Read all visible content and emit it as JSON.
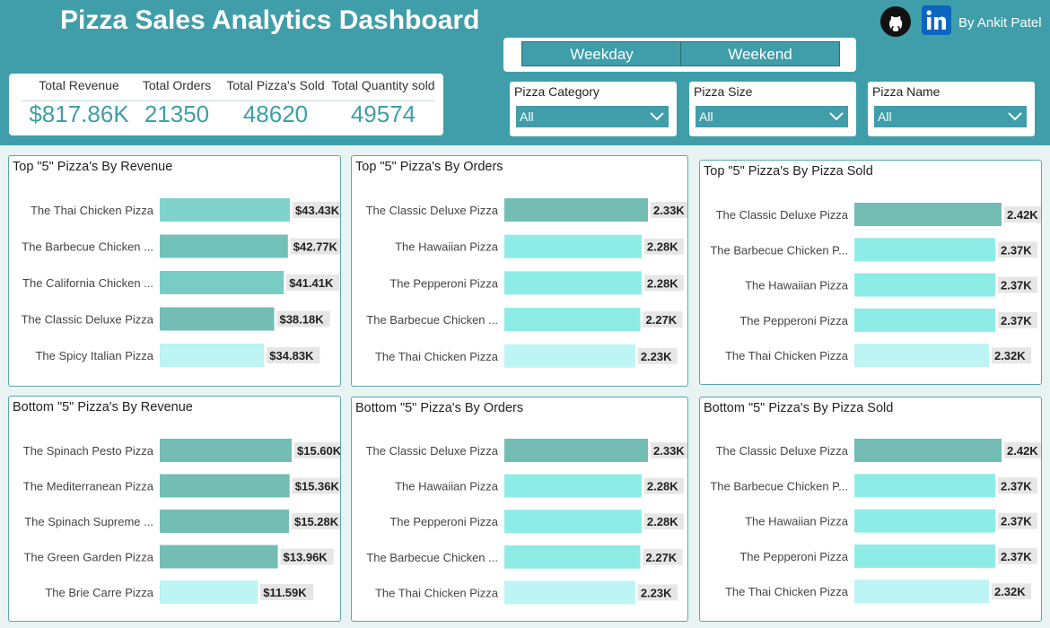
{
  "header": {
    "title": "Pizza Sales Analytics Dashboard",
    "author": "By Ankit Patel",
    "github_icon": "github-icon",
    "linkedin_icon": "linkedin-icon",
    "background": "#3f9ea9"
  },
  "kpis": [
    {
      "label": "Total Revenue",
      "value": "$817.86K"
    },
    {
      "label": "Total Orders",
      "value": "21350"
    },
    {
      "label": "Total Pizza's Sold",
      "value": "48620"
    },
    {
      "label": "Total Quantity sold",
      "value": "49574"
    }
  ],
  "toggle": {
    "weekday": "Weekday",
    "weekend": "Weekend"
  },
  "slicers": [
    {
      "label": "Pizza Category",
      "value": "All"
    },
    {
      "label": "Pizza Size",
      "value": "All"
    },
    {
      "label": "Pizza Name",
      "value": "All"
    }
  ],
  "chart_data": [
    {
      "type": "bar",
      "orientation": "horizontal",
      "title": "Top \"5\" Pizza's By Revenue",
      "categories": [
        "The Thai Chicken Pizza",
        "The Barbecue Chicken Pizza",
        "The California Chicken Pizza",
        "The Classic Deluxe Pizza",
        "The Spicy Italian Pizza"
      ],
      "display_categories": [
        "The Thai Chicken Pizza",
        "The Barbecue Chicken ...",
        "The California Chicken ...",
        "The Classic Deluxe Pizza",
        "The Spicy Italian Pizza"
      ],
      "values": [
        43430,
        42770,
        41410,
        38180,
        34830
      ],
      "labels": [
        "$43.43K",
        "$42.77K",
        "$41.41K",
        "$38.18K",
        "$34.83K"
      ],
      "colors": [
        "#7fd3cb",
        "#73c2ba",
        "#79ccc4",
        "#73bdb5",
        "#bdf4f4"
      ]
    },
    {
      "type": "bar",
      "orientation": "horizontal",
      "title": "Top \"5\" Pizza's By Orders",
      "categories": [
        "The Classic Deluxe Pizza",
        "The Hawaiian Pizza",
        "The Pepperoni Pizza",
        "The Barbecue Chicken Pizza",
        "The Thai Chicken Pizza"
      ],
      "display_categories": [
        "The Classic Deluxe Pizza",
        "The Hawaiian Pizza",
        "The Pepperoni Pizza",
        "The Barbecue Chicken ...",
        "The Thai Chicken Pizza"
      ],
      "values": [
        2330,
        2280,
        2280,
        2270,
        2230
      ],
      "labels": [
        "2.33K",
        "2.28K",
        "2.28K",
        "2.27K",
        "2.23K"
      ],
      "colors": [
        "#73bdb5",
        "#8eece7",
        "#8eece7",
        "#8eece7",
        "#bdf4f4"
      ]
    },
    {
      "type": "bar",
      "orientation": "horizontal",
      "title": "Top \"5\" Pizza's By Pizza Sold",
      "categories": [
        "The Classic Deluxe Pizza",
        "The Barbecue Chicken Pizza",
        "The Hawaiian Pizza",
        "The Pepperoni Pizza",
        "The Thai Chicken Pizza"
      ],
      "display_categories": [
        "The Classic Deluxe Pizza",
        "The Barbecue Chicken P...",
        "The Hawaiian Pizza",
        "The Pepperoni Pizza",
        "The Thai Chicken Pizza"
      ],
      "values": [
        2420,
        2370,
        2370,
        2370,
        2320
      ],
      "labels": [
        "2.42K",
        "2.37K",
        "2.37K",
        "2.37K",
        "2.32K"
      ],
      "colors": [
        "#73bdb5",
        "#8eece7",
        "#8eece7",
        "#8eece7",
        "#bdf4f4"
      ]
    },
    {
      "type": "bar",
      "orientation": "horizontal",
      "title": "Bottom \"5\" Pizza's By Revenue",
      "categories": [
        "The Spinach Pesto Pizza",
        "The Mediterranean Pizza",
        "The Spinach Supreme Pizza",
        "The Green Garden Pizza",
        "The Brie Carre Pizza"
      ],
      "display_categories": [
        "The Spinach Pesto Pizza",
        "The Mediterranean Pizza",
        "The Spinach Supreme ...",
        "The Green Garden Pizza",
        "The Brie Carre Pizza"
      ],
      "values": [
        15600,
        15360,
        15280,
        13960,
        11590
      ],
      "labels": [
        "$15.60K",
        "$15.36K",
        "$15.28K",
        "$13.96K",
        "$11.59K"
      ],
      "colors": [
        "#73bdb5",
        "#73bdb5",
        "#73bdb5",
        "#73bdb5",
        "#bdf4f4"
      ]
    },
    {
      "type": "bar",
      "orientation": "horizontal",
      "title": "Bottom \"5\" Pizza's By Orders",
      "categories": [
        "The Classic Deluxe Pizza",
        "The Hawaiian Pizza",
        "The Pepperoni Pizza",
        "The Barbecue Chicken Pizza",
        "The Thai Chicken Pizza"
      ],
      "display_categories": [
        "The Classic Deluxe Pizza",
        "The Hawaiian Pizza",
        "The Pepperoni Pizza",
        "The Barbecue Chicken ...",
        "The Thai Chicken Pizza"
      ],
      "values": [
        2330,
        2280,
        2280,
        2270,
        2230
      ],
      "labels": [
        "2.33K",
        "2.28K",
        "2.28K",
        "2.27K",
        "2.23K"
      ],
      "colors": [
        "#73bdb5",
        "#8eece7",
        "#8eece7",
        "#8eece7",
        "#bdf4f4"
      ]
    },
    {
      "type": "bar",
      "orientation": "horizontal",
      "title": "Bottom \"5\" Pizza's By Pizza Sold",
      "categories": [
        "The Classic Deluxe Pizza",
        "The Barbecue Chicken Pizza",
        "The Hawaiian Pizza",
        "The Pepperoni Pizza",
        "The Thai Chicken Pizza"
      ],
      "display_categories": [
        "The Classic Deluxe Pizza",
        "The Barbecue Chicken P...",
        "The Hawaiian Pizza",
        "The Pepperoni Pizza",
        "The Thai Chicken Pizza"
      ],
      "values": [
        2420,
        2370,
        2370,
        2370,
        2320
      ],
      "labels": [
        "2.42K",
        "2.37K",
        "2.37K",
        "2.37K",
        "2.32K"
      ],
      "colors": [
        "#73bdb5",
        "#8eece7",
        "#8eece7",
        "#8eece7",
        "#bdf4f4"
      ]
    }
  ]
}
